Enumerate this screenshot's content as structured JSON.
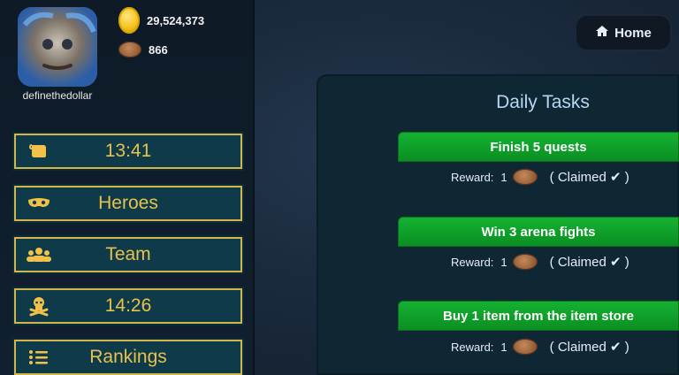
{
  "player": {
    "username": "definethedollar",
    "gold": "29,524,373",
    "bread": "866"
  },
  "header": {
    "home_label": "Home"
  },
  "menu": {
    "items": [
      {
        "label": "13:41",
        "icon": "scroll-icon"
      },
      {
        "label": "Heroes",
        "icon": "mask-icon"
      },
      {
        "label": "Team",
        "icon": "team-icon"
      },
      {
        "label": "14:26",
        "icon": "skull-crossbones-icon"
      },
      {
        "label": "Rankings",
        "icon": "list-icon"
      }
    ]
  },
  "daily_tasks": {
    "title": "Daily Tasks",
    "reward_label": "Reward:",
    "tasks": [
      {
        "name": "Finish 5 quests",
        "reward_amount": "1",
        "status": "( Claimed ✔ )"
      },
      {
        "name": "Win 3 arena fights",
        "reward_amount": "1",
        "status": "( Claimed ✔ )"
      },
      {
        "name": "Buy 1 item from the item store",
        "reward_amount": "1",
        "status": "( Claimed ✔ )"
      }
    ]
  },
  "colors": {
    "accent_gold": "#e7c24c",
    "task_green": "#16b232",
    "panel_bg": "#0f2633"
  }
}
